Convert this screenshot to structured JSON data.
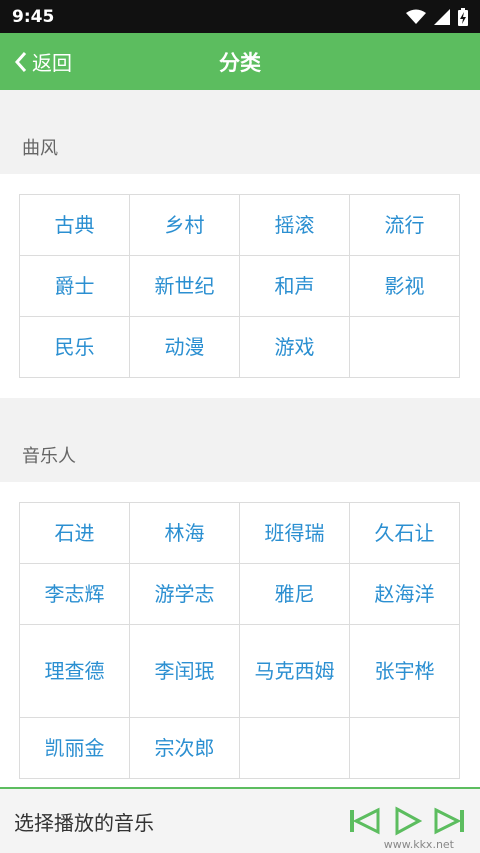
{
  "status": {
    "time": "9:45"
  },
  "appbar": {
    "back_label": "返回",
    "title": "分类"
  },
  "sections": [
    {
      "title": "曲风",
      "rows": [
        [
          "古典",
          "乡村",
          "摇滚",
          "流行"
        ],
        [
          "爵士",
          "新世纪",
          "和声",
          "影视"
        ],
        [
          "民乐",
          "动漫",
          "游戏",
          ""
        ]
      ]
    },
    {
      "title": "音乐人",
      "rows": [
        [
          "石进",
          "林海",
          "班得瑞",
          "久石让"
        ],
        [
          "李志辉",
          "游学志",
          "雅尼",
          "赵海洋"
        ],
        [
          "理查德",
          "李闰珉",
          "马克西姆",
          "张宇桦"
        ],
        [
          "凯丽金",
          "宗次郎",
          "",
          ""
        ]
      ]
    }
  ],
  "bottom": {
    "label": "选择播放的音乐"
  },
  "watermark": "www.kkx.net",
  "colors": {
    "accent": "#5cbd5f",
    "link": "#2b8fd1"
  }
}
